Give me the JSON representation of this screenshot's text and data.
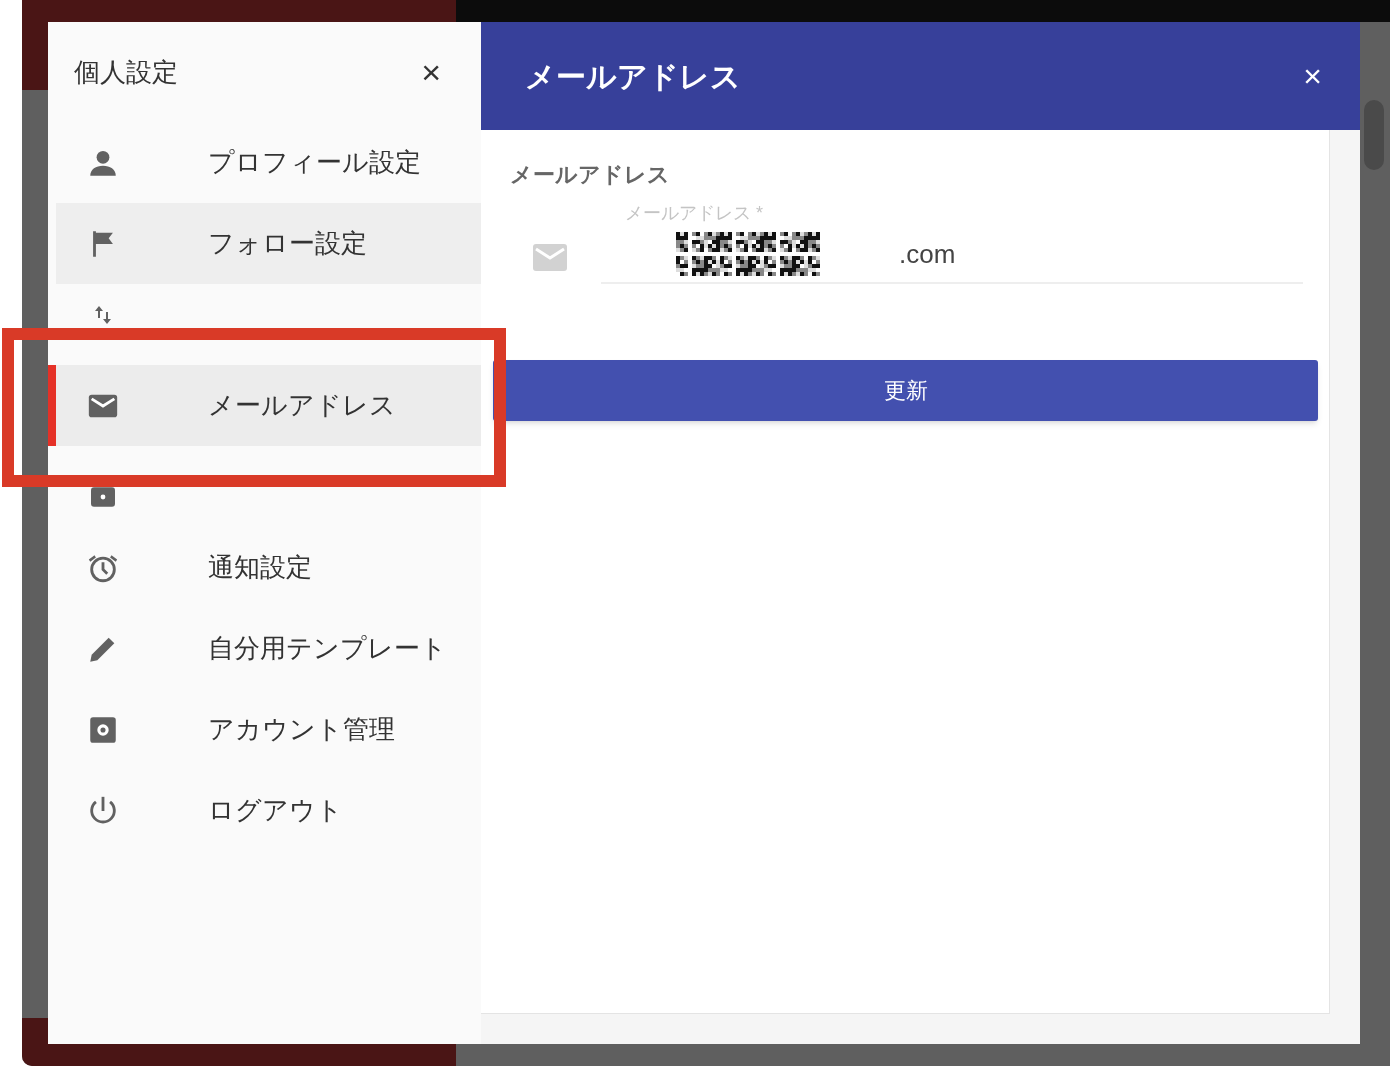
{
  "sidebar": {
    "title": "個人設定",
    "close": "×",
    "items": [
      {
        "label": "プロフィール設定",
        "selected": false,
        "highlighted": false
      },
      {
        "label": "フォロー設定",
        "selected": false,
        "highlighted": true
      },
      {
        "selected": false,
        "highlighted": false
      },
      {
        "label": "メールアドレス",
        "selected": true,
        "highlighted": false
      },
      {
        "selected": false,
        "highlighted": false
      },
      {
        "label": "通知設定",
        "selected": false,
        "highlighted": false
      },
      {
        "label": "自分用テンプレート",
        "selected": false,
        "highlighted": false
      },
      {
        "label": "アカウント管理",
        "selected": false,
        "highlighted": false
      },
      {
        "label": "ログアウト",
        "selected": false,
        "highlighted": false
      }
    ]
  },
  "panel": {
    "title": "メールアドレス",
    "close": "×",
    "section": "メールアドレス",
    "email_field": {
      "label": "メールアドレス *",
      "value": ".com",
      "redacted": true
    },
    "submit": "更新"
  },
  "annotation": {
    "kind": "frame",
    "color": "#d93a27"
  }
}
